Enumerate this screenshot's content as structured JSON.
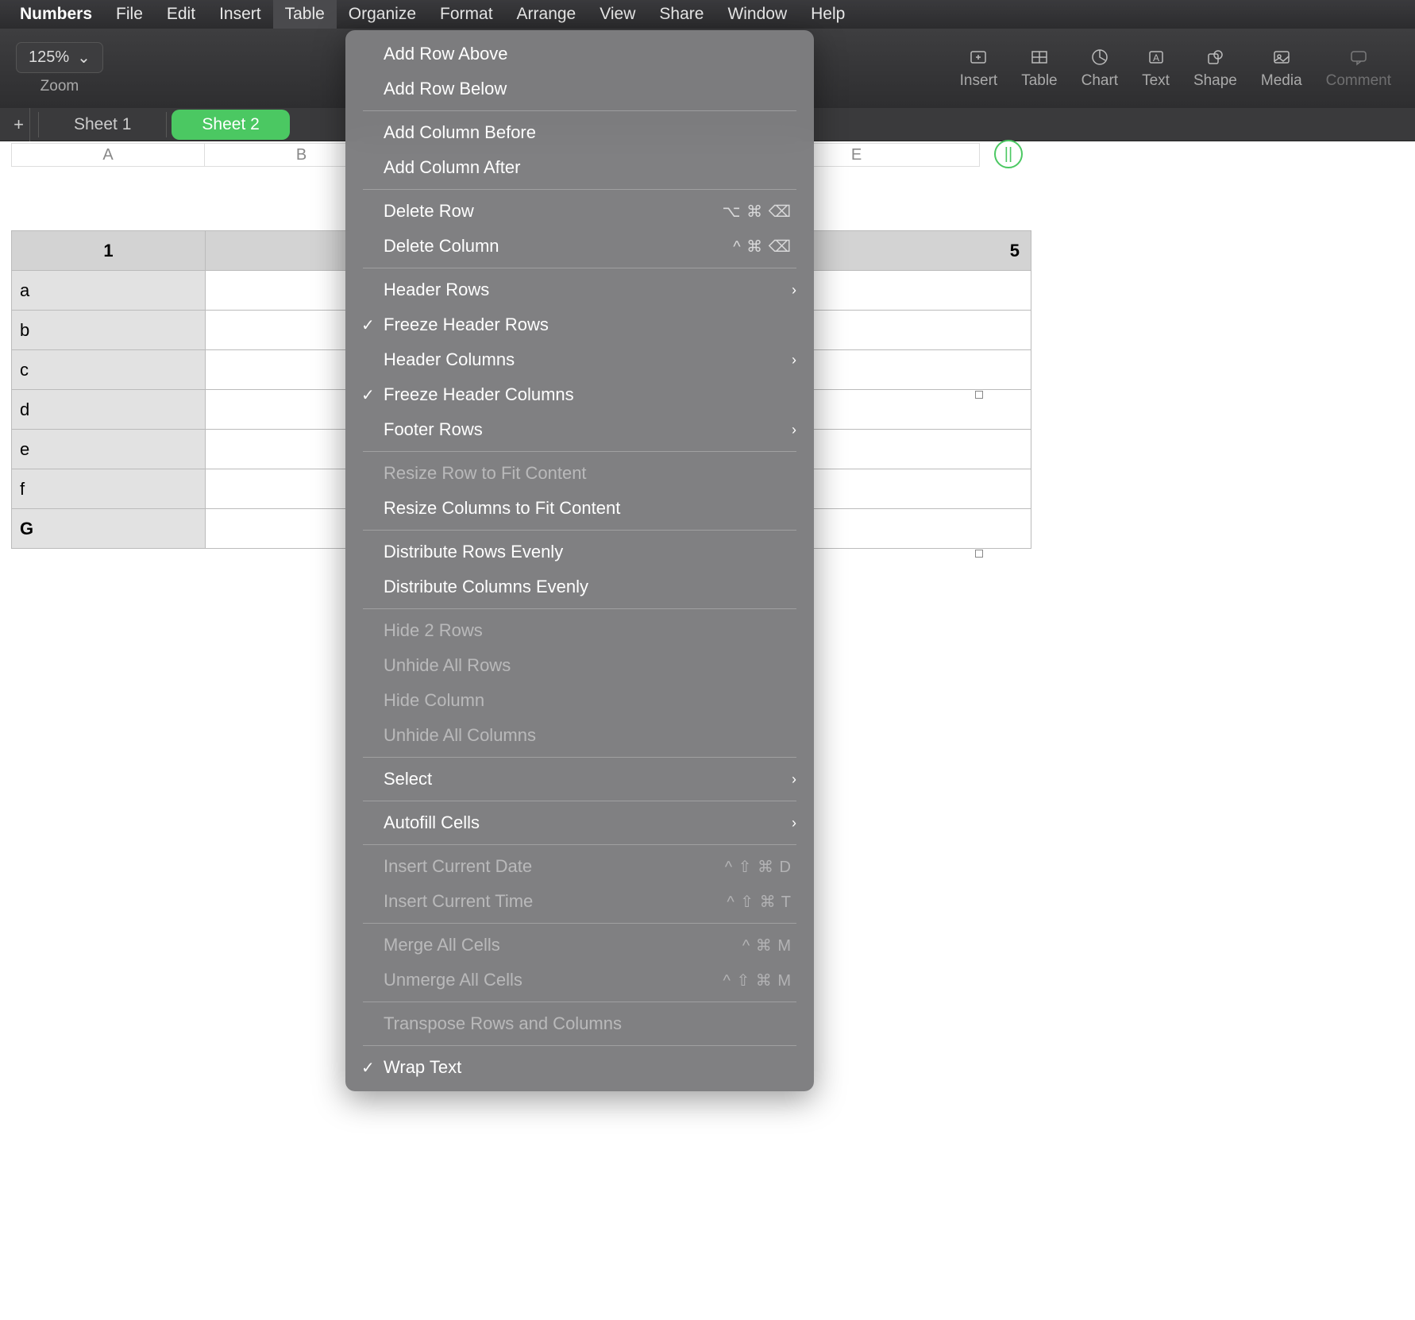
{
  "menubar": {
    "app": "Numbers",
    "items": [
      "File",
      "Edit",
      "Insert",
      "Table",
      "Organize",
      "Format",
      "Arrange",
      "View",
      "Share",
      "Window",
      "Help"
    ],
    "selected": "Table"
  },
  "toolbar": {
    "view_fragment": "v",
    "zoom_value": "125%",
    "zoom_label": "Zoom",
    "buttons": [
      {
        "label": "Insert"
      },
      {
        "label": "Table"
      },
      {
        "label": "Chart"
      },
      {
        "label": "Text"
      },
      {
        "label": "Shape"
      },
      {
        "label": "Media"
      },
      {
        "label": "Comment"
      }
    ]
  },
  "sheets": {
    "tabs": [
      "Sheet 1",
      "Sheet 2"
    ],
    "active": "Sheet 2"
  },
  "col_ruler": [
    "A",
    "B",
    "",
    "",
    "E"
  ],
  "table": {
    "header_row": [
      "1",
      "",
      "",
      "",
      "5"
    ],
    "rows": [
      "a",
      "b",
      "c",
      "d",
      "e",
      "f",
      "G"
    ]
  },
  "add_col_glyph": "||",
  "dropdown": {
    "groups": [
      [
        {
          "label": "Add Row Above"
        },
        {
          "label": "Add Row Below"
        }
      ],
      [
        {
          "label": "Add Column Before"
        },
        {
          "label": "Add Column After"
        }
      ],
      [
        {
          "label": "Delete Row",
          "shortcut": "⌥ ⌘ ⌫"
        },
        {
          "label": "Delete Column",
          "shortcut": "^ ⌘ ⌫"
        }
      ],
      [
        {
          "label": "Header Rows",
          "submenu": true
        },
        {
          "label": "Freeze Header Rows",
          "checked": true
        },
        {
          "label": "Header Columns",
          "submenu": true
        },
        {
          "label": "Freeze Header Columns",
          "checked": true
        },
        {
          "label": "Footer Rows",
          "submenu": true
        }
      ],
      [
        {
          "label": "Resize Row to Fit Content",
          "disabled": true
        },
        {
          "label": "Resize Columns to Fit Content"
        }
      ],
      [
        {
          "label": "Distribute Rows Evenly"
        },
        {
          "label": "Distribute Columns Evenly"
        }
      ],
      [
        {
          "label": "Hide 2 Rows",
          "disabled": true
        },
        {
          "label": "Unhide All Rows",
          "disabled": true
        },
        {
          "label": "Hide Column",
          "disabled": true
        },
        {
          "label": "Unhide All Columns",
          "disabled": true
        }
      ],
      [
        {
          "label": "Select",
          "submenu": true
        }
      ],
      [
        {
          "label": "Autofill Cells",
          "submenu": true
        }
      ],
      [
        {
          "label": "Insert Current Date",
          "shortcut": "^ ⇧ ⌘ D",
          "disabled": true
        },
        {
          "label": "Insert Current Time",
          "shortcut": "^ ⇧ ⌘ T",
          "disabled": true
        }
      ],
      [
        {
          "label": "Merge All Cells",
          "shortcut": "^ ⌘ M",
          "disabled": true
        },
        {
          "label": "Unmerge All Cells",
          "shortcut": "^ ⇧ ⌘ M",
          "disabled": true
        }
      ],
      [
        {
          "label": "Transpose Rows and Columns",
          "disabled": true
        }
      ],
      [
        {
          "label": "Wrap Text",
          "checked": true
        }
      ]
    ]
  }
}
